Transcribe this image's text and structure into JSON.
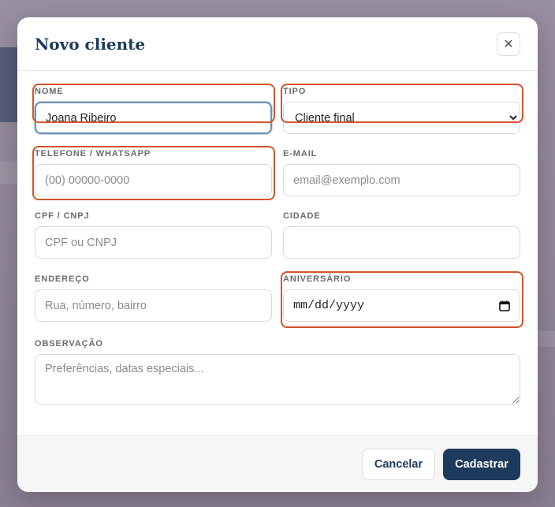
{
  "modal": {
    "title": "Novo cliente",
    "close_glyph": "✕"
  },
  "form": {
    "nome": {
      "label": "NOME",
      "value": "Joana Ribeiro"
    },
    "tipo": {
      "label": "TIPO",
      "value": "Cliente final"
    },
    "telefone": {
      "label": "TELEFONE / WHATSAPP",
      "placeholder": "(00) 00000-0000"
    },
    "email": {
      "label": "E-MAIL",
      "placeholder": "email@exemplo.com"
    },
    "cpf": {
      "label": "CPF / CNPJ",
      "placeholder": "CPF ou CNPJ"
    },
    "cidade": {
      "label": "CIDADE",
      "placeholder": ""
    },
    "endereco": {
      "label": "ENDEREÇO",
      "placeholder": "Rua, número, bairro"
    },
    "aniversario": {
      "label": "ANIVERSÁRIO",
      "value": "mm/dd/yyyy"
    },
    "observacao": {
      "label": "OBSERVAÇÃO",
      "placeholder": "Preferências, datas especiais..."
    }
  },
  "footer": {
    "cancel_label": "Cancelar",
    "submit_label": "Cadastrar"
  },
  "colors": {
    "primary": "#1e3a5c",
    "highlight": "#d4532b",
    "backdrop": "#8f8598"
  }
}
